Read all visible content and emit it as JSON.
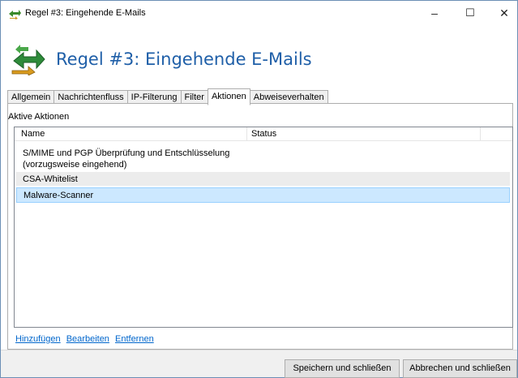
{
  "window": {
    "title": "Regel #3: Eingehende E-Mails",
    "controls": {
      "minimize": "–",
      "maximize": "☐",
      "close": "✕"
    }
  },
  "header": {
    "title": "Regel #3: Eingehende E-Mails",
    "icon": "rule-arrows-icon"
  },
  "tabs": [
    {
      "label": "Allgemein",
      "active": false
    },
    {
      "label": "Nachrichtenfluss",
      "active": false
    },
    {
      "label": "IP-Filterung",
      "active": false
    },
    {
      "label": "Filter",
      "active": false
    },
    {
      "label": "Aktionen",
      "active": true
    },
    {
      "label": "Abweiseverhalten",
      "active": false
    }
  ],
  "actions": {
    "section_label": "Aktive Aktionen",
    "columns": {
      "name": "Name",
      "status": "Status"
    },
    "rows": [
      {
        "name": "S/MIME und PGP Überprüfung und Entschlüsselung (vorzugsweise eingehend)",
        "status": ""
      },
      {
        "name": "CSA-Whitelist",
        "status": ""
      },
      {
        "name": "Malware-Scanner",
        "status": "",
        "selected": true
      }
    ]
  },
  "links": {
    "add": "Hinzufügen",
    "edit": "Bearbeiten",
    "remove": "Entfernen"
  },
  "buttons": {
    "save_close": "Speichern und schließen",
    "cancel_close": "Abbrechen und schließen"
  },
  "colors": {
    "accent_title": "#1f5fa8",
    "link": "#0066cc",
    "selected_row": "#cce8ff"
  }
}
